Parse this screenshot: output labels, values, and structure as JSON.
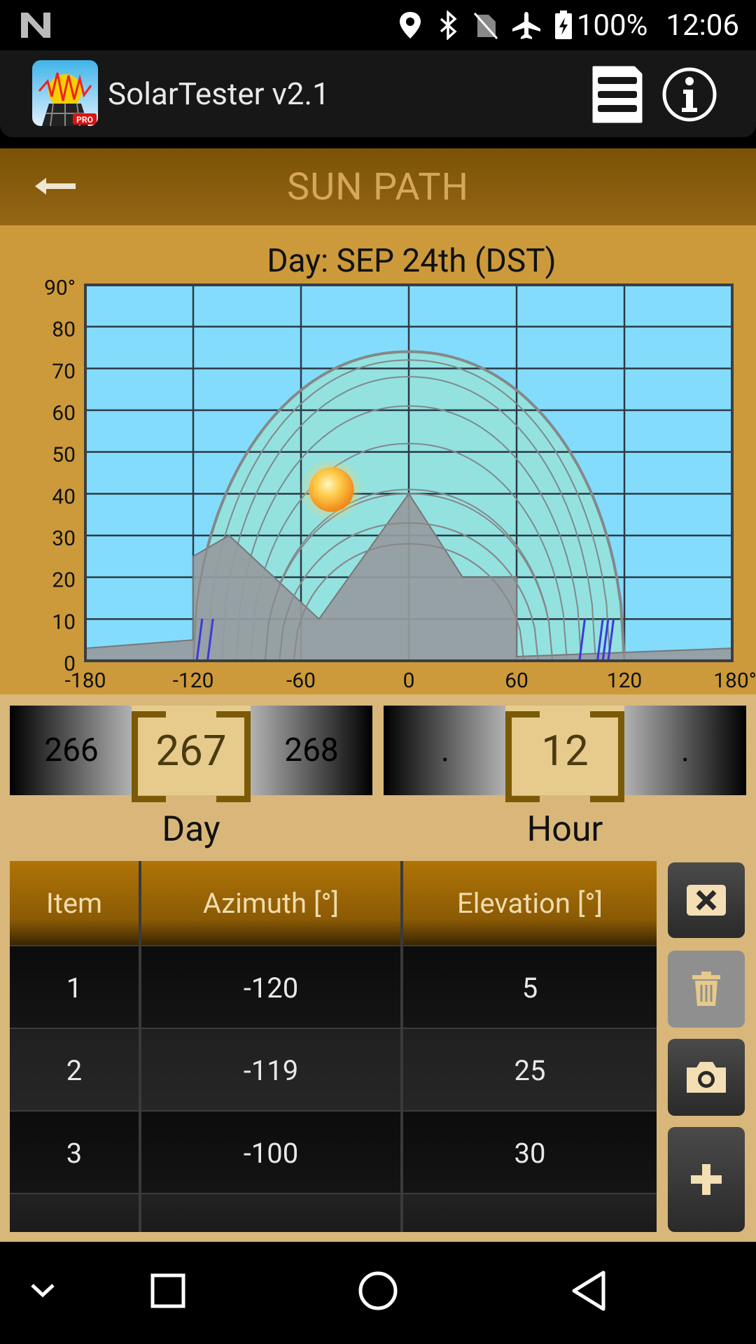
{
  "status_bar": {
    "battery": "100%",
    "time": "12:06"
  },
  "app": {
    "title": "SolarTester v2.1",
    "logo_badge": "PRO"
  },
  "screen": {
    "title": "SUN PATH",
    "chart_title": "Day: SEP 24th (DST)"
  },
  "chart_data": {
    "type": "area",
    "title": "Day: SEP 24th (DST)",
    "x_ticks": [
      "-180",
      "-120",
      "-60",
      "0",
      "60",
      "120",
      "180°"
    ],
    "y_ticks": [
      "0",
      "10",
      "20",
      "30",
      "40",
      "50",
      "60",
      "70",
      "80",
      "90°"
    ],
    "xlim": [
      -180,
      180
    ],
    "ylim": [
      0,
      90
    ],
    "grid": true,
    "sun_position": {
      "azimuth": -43,
      "elevation": 41
    },
    "sun_path_max_elevation": 74,
    "obstruction_profile": {
      "x": [
        -180,
        -120,
        -120,
        -100,
        -50,
        0,
        30,
        60,
        60,
        180
      ],
      "y": [
        3,
        5,
        25,
        30,
        10,
        40,
        20,
        20,
        1,
        3
      ]
    }
  },
  "day_picker": {
    "prev": "266",
    "current": "267",
    "next": "268",
    "label": "Day"
  },
  "hour_picker": {
    "prev": ".",
    "current": "12",
    "next": ".",
    "label": "Hour"
  },
  "table": {
    "headers": [
      "Item",
      "Azimuth [°]",
      "Elevation [°]"
    ],
    "rows": [
      [
        "1",
        "-120",
        "5"
      ],
      [
        "2",
        "-119",
        "25"
      ],
      [
        "3",
        "-100",
        "30"
      ]
    ]
  },
  "icons": {
    "close": "close-icon",
    "delete": "trash-icon",
    "camera": "camera-icon",
    "add": "plus-icon"
  }
}
